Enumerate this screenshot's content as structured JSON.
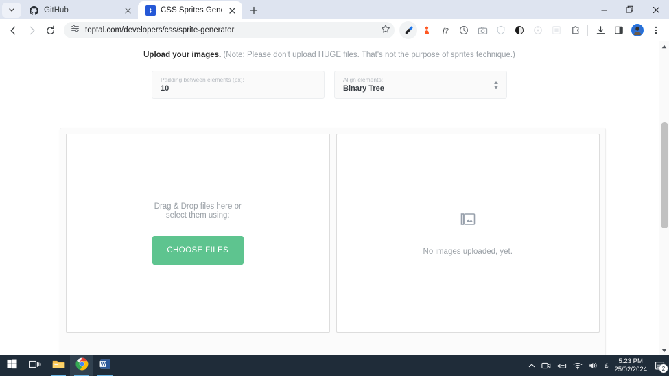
{
  "browser": {
    "tab_search_icon": "chevron-down-icon",
    "tabs": [
      {
        "title": "GitHub",
        "favicon": "github-icon",
        "active": false,
        "close_label": "×"
      },
      {
        "title": "CSS Sprites Generator Tool | To",
        "favicon": "sprite-site-icon",
        "active": true,
        "close_label": "×"
      }
    ],
    "new_tab_label": "+",
    "window_controls": {
      "minimize": "minimize-icon",
      "maximize": "restore-icon",
      "close": "close-icon"
    },
    "toolbar": {
      "back": "back-arrow-icon",
      "forward": "forward-arrow-icon",
      "reload": "reload-icon",
      "site_settings": "page-settings-icon",
      "url": "toptal.com/developers/css/sprite-generator",
      "bookmark": "star-icon",
      "extensions": [
        "eyedropper-icon",
        "orange-extension-icon",
        "formula-icon",
        "clock-icon",
        "camera-icon",
        "shield-icon",
        "dark-circle-icon",
        "target-icon",
        "grid-icon",
        "puzzle-icon"
      ],
      "downloads": "download-icon",
      "side_panel": "side-panel-icon",
      "profile": "profile-avatar",
      "menu": "three-dot-menu-icon"
    }
  },
  "page": {
    "notice": {
      "bold": "Upload your images.",
      "rest": " (Note: Please don't upload HUGE files. That's not the purpose of sprites technique.)"
    },
    "controls": [
      {
        "label": "Padding between elements (px):",
        "value": "10",
        "type": "number-input"
      },
      {
        "label": "Align elements:",
        "value": "Binary Tree",
        "type": "select"
      }
    ],
    "dropzone": {
      "line1": "Drag & Drop files here or",
      "line2": "select them using:",
      "button": "CHOOSE FILES"
    },
    "preview": {
      "icon": "images-stack-icon",
      "empty_text": "No images uploaded, yet."
    },
    "colors": {
      "accent_green": "#5ec48f",
      "muted_text": "#9aa0a6"
    }
  },
  "taskbar": {
    "items": [
      {
        "name": "start-button",
        "icon": "windows-logo-icon"
      },
      {
        "name": "task-view-button",
        "icon": "task-view-icon"
      },
      {
        "name": "file-explorer-button",
        "icon": "folder-icon"
      },
      {
        "name": "chrome-button",
        "icon": "chrome-icon"
      },
      {
        "name": "word-button",
        "icon": "word-icon"
      }
    ],
    "tray": {
      "overflow": "chevron-up-icon",
      "icons": [
        "meet-camera-icon",
        "device-icon",
        "wifi-icon",
        "volume-icon"
      ],
      "currency": "£",
      "time": "5:23 PM",
      "date": "25/02/2024",
      "notification_count": "2"
    }
  }
}
